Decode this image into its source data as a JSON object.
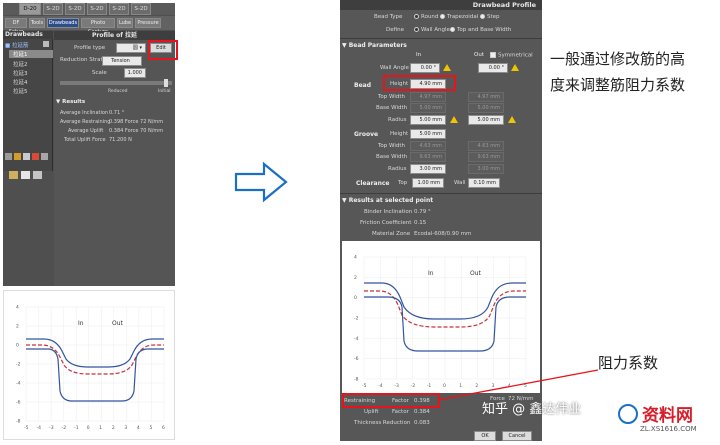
{
  "left": {
    "tabs": [
      "2-20",
      "S-2D",
      "S-2D",
      "S-2D",
      "S-2D",
      "S-2D"
    ],
    "active_tab": "D-20",
    "toolbar": [
      "DF Setup",
      "Tools",
      "Drawbeads",
      "Photo Capture",
      "Lube",
      "Pressure"
    ],
    "active_tool": "Drawbeads",
    "list_title": "Drawbeads",
    "list_root": "■ 拉延筋",
    "list_items": [
      "拉延1",
      "拉延2",
      "拉延3",
      "拉延4",
      "拉延5"
    ],
    "profile_title": "Profile of 拉延",
    "profile_type_label": "Profile type",
    "profile_type_value": "圆 ▾",
    "edit_label": "Edit",
    "reduction_label": "Reduction Strategy",
    "reduction_value": "Tension",
    "scale_label": "Scale",
    "scale_value": "1.000",
    "slider_min": "Reduced",
    "slider_max": "Initial",
    "results_title": "▼ Results",
    "results": [
      {
        "label": "Average Inclination",
        "value": "0.71 °"
      },
      {
        "label": "Average Restraining",
        "value": "0.398   Force  72 N/mm"
      },
      {
        "label": "Average Uplift",
        "value": "0.384   Force  70 N/mm"
      },
      {
        "label": "Total Uplift Force",
        "value": "71.200 N"
      }
    ],
    "chart": {
      "y_ticks": [
        "4",
        "2",
        "0",
        "-2",
        "-4",
        "-6",
        "-8"
      ],
      "x_ticks": [
        "-5",
        "-4",
        "-3",
        "-2",
        "-1",
        "0",
        "1",
        "2",
        "3",
        "4",
        "5",
        "6"
      ],
      "in_label": "In",
      "out_label": "Out"
    }
  },
  "arrow": "⇨",
  "right": {
    "title": "Drawbead Profile",
    "bead_type_label": "Bead Type",
    "bead_type_options": [
      "Round",
      "Trapezoidal",
      "Step"
    ],
    "define_label": "Define",
    "define_options": [
      "Wall Angle",
      "Top and Base Width"
    ],
    "bead_params_title": "▼ Bead Parameters",
    "col_in": "In",
    "col_out": "Out",
    "symmetrical_label": "Symmetrical",
    "wall_angle_label": "Wall Angle",
    "wall_angle_in": "0.00 °",
    "wall_angle_out": "0.00 °",
    "bead_label": "Bead",
    "height_label": "Height",
    "height_in": "4.90 mm",
    "top_width_label": "Top Width",
    "top_width_in": "4.97 mm",
    "top_width_out": "4.97 mm",
    "base_width_label": "Base Width",
    "base_width_in": "5.00 mm",
    "base_width_out": "5.00 mm",
    "radius_label": "Radius",
    "radius_in": "5.00 mm",
    "radius_out": "5.00 mm",
    "groove_label": "Groove",
    "g_height_label": "Height",
    "g_height_in": "5.00 mm",
    "g_top_width_label": "Top Width",
    "g_top_width_in": "4.63 mm",
    "g_top_width_out": "4.63 mm",
    "g_base_width_label": "Base Width",
    "g_base_width_in": "9.63 mm",
    "g_base_width_out": "9.63 mm",
    "g_radius_label": "Radius",
    "g_radius_in": "3.00 mm",
    "g_radius_out": "3.00 mm",
    "clearance_label": "Clearance",
    "top_label": "Top",
    "clear_top": "1.00 mm",
    "wall_label": "Wall",
    "clear_wall": "0.10 mm",
    "results_title": "▼ Results at selected point",
    "binder_incl_label": "Binder Inclination",
    "binder_incl_value": "0.79 °",
    "friction_label": "Friction Coefficient",
    "friction_value": "0.15",
    "material_label": "Material Zone",
    "material_value": "Ecodal-608/0.90 mm",
    "chart": {
      "y_ticks": [
        "4",
        "2",
        "0",
        "-2",
        "-4",
        "-6",
        "-8"
      ],
      "x_ticks": [
        "-5",
        "-4",
        "-3",
        "-2",
        "-1",
        "0",
        "1",
        "2",
        "3",
        "4",
        "5"
      ],
      "in_label": "In",
      "out_label": "Out"
    },
    "restraining_label": "Restraining",
    "factor_label": "Factor",
    "restraining_factor": "0.398",
    "force_label": "Force",
    "restraining_force": "72 N/mm",
    "uplift_label": "Uplift",
    "uplift_factor": "0.384",
    "thickness_label": "Thickness Reduction",
    "thickness_value": "0.083",
    "ok_label": "OK",
    "cancel_label": "Cancel"
  },
  "annotations": {
    "note_height": "一般通过修改筋的高度来调整筋阻力系数",
    "note_line1": "一般通过修改筋的高",
    "note_line2": "度来调整筋阻力系数",
    "note_force": "阻力系数"
  },
  "watermark": {
    "zhihu": "知乎 @ 鑫达伟业",
    "logo": "资料网",
    "site": "ZL.XS1616.COM"
  },
  "colors": {
    "panel": "#4f4f4f",
    "header": "#3e3e3e",
    "highlight": "#e8141c",
    "arrow": "#1b6fc4",
    "curve_blue": "#3355a0",
    "curve_red": "#c8303a"
  }
}
